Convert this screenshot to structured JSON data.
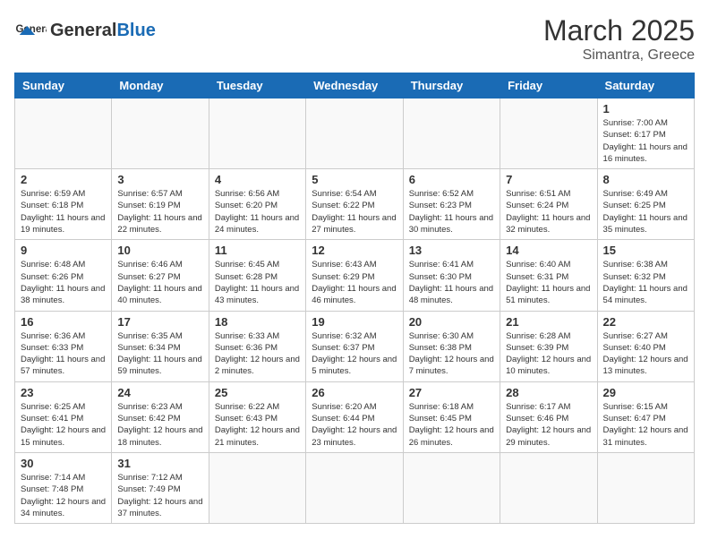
{
  "header": {
    "logo_general": "General",
    "logo_blue": "Blue",
    "title": "March 2025",
    "subtitle": "Simantra, Greece"
  },
  "weekdays": [
    "Sunday",
    "Monday",
    "Tuesday",
    "Wednesday",
    "Thursday",
    "Friday",
    "Saturday"
  ],
  "weeks": [
    [
      {
        "day": "",
        "info": ""
      },
      {
        "day": "",
        "info": ""
      },
      {
        "day": "",
        "info": ""
      },
      {
        "day": "",
        "info": ""
      },
      {
        "day": "",
        "info": ""
      },
      {
        "day": "",
        "info": ""
      },
      {
        "day": "1",
        "info": "Sunrise: 7:00 AM\nSunset: 6:17 PM\nDaylight: 11 hours\nand 16 minutes."
      }
    ],
    [
      {
        "day": "2",
        "info": "Sunrise: 6:59 AM\nSunset: 6:18 PM\nDaylight: 11 hours\nand 19 minutes."
      },
      {
        "day": "3",
        "info": "Sunrise: 6:57 AM\nSunset: 6:19 PM\nDaylight: 11 hours\nand 22 minutes."
      },
      {
        "day": "4",
        "info": "Sunrise: 6:56 AM\nSunset: 6:20 PM\nDaylight: 11 hours\nand 24 minutes."
      },
      {
        "day": "5",
        "info": "Sunrise: 6:54 AM\nSunset: 6:22 PM\nDaylight: 11 hours\nand 27 minutes."
      },
      {
        "day": "6",
        "info": "Sunrise: 6:52 AM\nSunset: 6:23 PM\nDaylight: 11 hours\nand 30 minutes."
      },
      {
        "day": "7",
        "info": "Sunrise: 6:51 AM\nSunset: 6:24 PM\nDaylight: 11 hours\nand 32 minutes."
      },
      {
        "day": "8",
        "info": "Sunrise: 6:49 AM\nSunset: 6:25 PM\nDaylight: 11 hours\nand 35 minutes."
      }
    ],
    [
      {
        "day": "9",
        "info": "Sunrise: 6:48 AM\nSunset: 6:26 PM\nDaylight: 11 hours\nand 38 minutes."
      },
      {
        "day": "10",
        "info": "Sunrise: 6:46 AM\nSunset: 6:27 PM\nDaylight: 11 hours\nand 40 minutes."
      },
      {
        "day": "11",
        "info": "Sunrise: 6:45 AM\nSunset: 6:28 PM\nDaylight: 11 hours\nand 43 minutes."
      },
      {
        "day": "12",
        "info": "Sunrise: 6:43 AM\nSunset: 6:29 PM\nDaylight: 11 hours\nand 46 minutes."
      },
      {
        "day": "13",
        "info": "Sunrise: 6:41 AM\nSunset: 6:30 PM\nDaylight: 11 hours\nand 48 minutes."
      },
      {
        "day": "14",
        "info": "Sunrise: 6:40 AM\nSunset: 6:31 PM\nDaylight: 11 hours\nand 51 minutes."
      },
      {
        "day": "15",
        "info": "Sunrise: 6:38 AM\nSunset: 6:32 PM\nDaylight: 11 hours\nand 54 minutes."
      }
    ],
    [
      {
        "day": "16",
        "info": "Sunrise: 6:36 AM\nSunset: 6:33 PM\nDaylight: 11 hours\nand 57 minutes."
      },
      {
        "day": "17",
        "info": "Sunrise: 6:35 AM\nSunset: 6:34 PM\nDaylight: 11 hours\nand 59 minutes."
      },
      {
        "day": "18",
        "info": "Sunrise: 6:33 AM\nSunset: 6:36 PM\nDaylight: 12 hours\nand 2 minutes."
      },
      {
        "day": "19",
        "info": "Sunrise: 6:32 AM\nSunset: 6:37 PM\nDaylight: 12 hours\nand 5 minutes."
      },
      {
        "day": "20",
        "info": "Sunrise: 6:30 AM\nSunset: 6:38 PM\nDaylight: 12 hours\nand 7 minutes."
      },
      {
        "day": "21",
        "info": "Sunrise: 6:28 AM\nSunset: 6:39 PM\nDaylight: 12 hours\nand 10 minutes."
      },
      {
        "day": "22",
        "info": "Sunrise: 6:27 AM\nSunset: 6:40 PM\nDaylight: 12 hours\nand 13 minutes."
      }
    ],
    [
      {
        "day": "23",
        "info": "Sunrise: 6:25 AM\nSunset: 6:41 PM\nDaylight: 12 hours\nand 15 minutes."
      },
      {
        "day": "24",
        "info": "Sunrise: 6:23 AM\nSunset: 6:42 PM\nDaylight: 12 hours\nand 18 minutes."
      },
      {
        "day": "25",
        "info": "Sunrise: 6:22 AM\nSunset: 6:43 PM\nDaylight: 12 hours\nand 21 minutes."
      },
      {
        "day": "26",
        "info": "Sunrise: 6:20 AM\nSunset: 6:44 PM\nDaylight: 12 hours\nand 23 minutes."
      },
      {
        "day": "27",
        "info": "Sunrise: 6:18 AM\nSunset: 6:45 PM\nDaylight: 12 hours\nand 26 minutes."
      },
      {
        "day": "28",
        "info": "Sunrise: 6:17 AM\nSunset: 6:46 PM\nDaylight: 12 hours\nand 29 minutes."
      },
      {
        "day": "29",
        "info": "Sunrise: 6:15 AM\nSunset: 6:47 PM\nDaylight: 12 hours\nand 31 minutes."
      }
    ],
    [
      {
        "day": "30",
        "info": "Sunrise: 7:14 AM\nSunset: 7:48 PM\nDaylight: 12 hours\nand 34 minutes."
      },
      {
        "day": "31",
        "info": "Sunrise: 7:12 AM\nSunset: 7:49 PM\nDaylight: 12 hours\nand 37 minutes."
      },
      {
        "day": "",
        "info": ""
      },
      {
        "day": "",
        "info": ""
      },
      {
        "day": "",
        "info": ""
      },
      {
        "day": "",
        "info": ""
      },
      {
        "day": "",
        "info": ""
      }
    ]
  ]
}
